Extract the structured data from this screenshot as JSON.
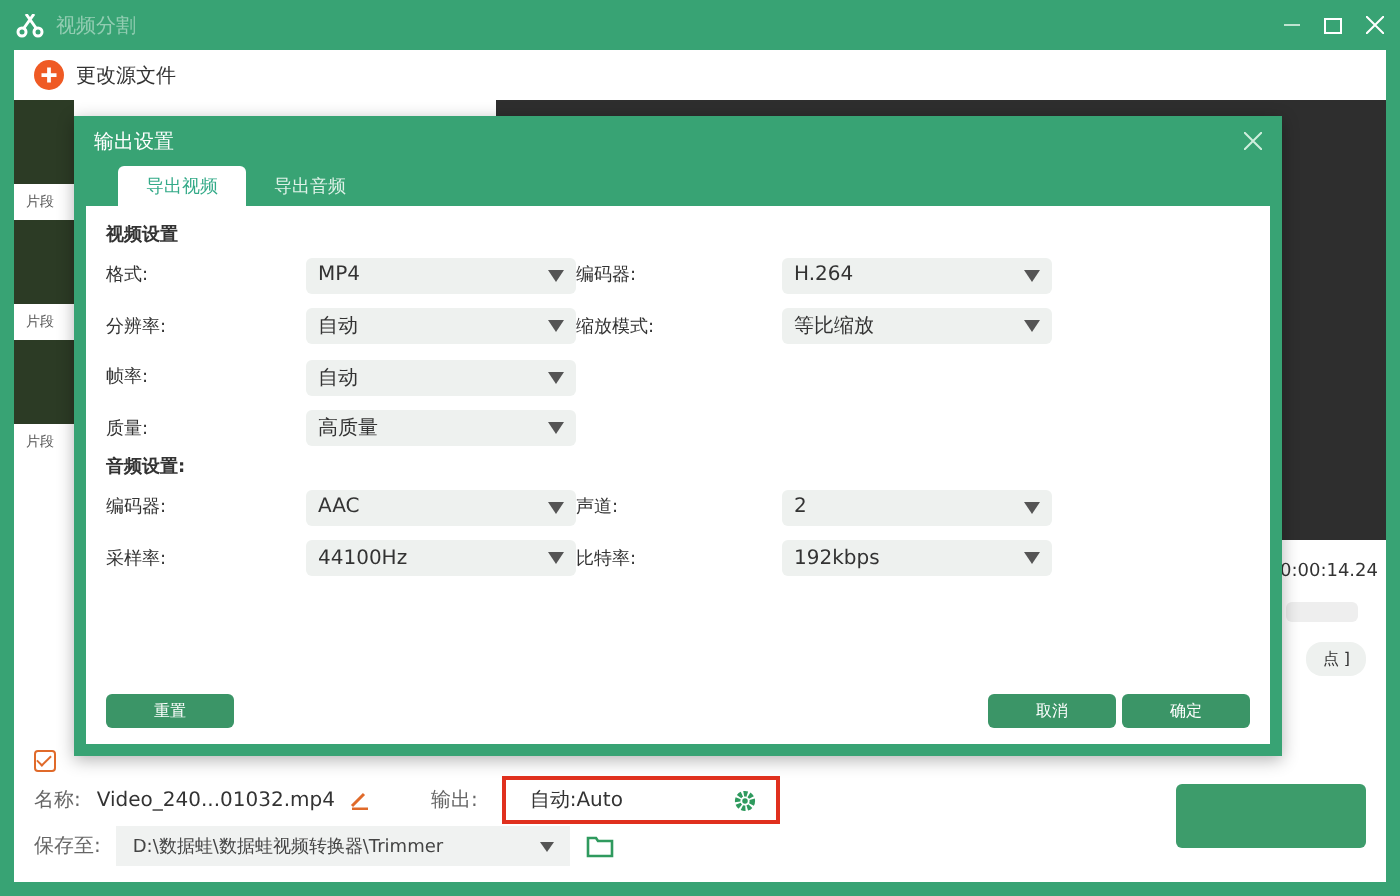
{
  "window": {
    "title": "视频分割"
  },
  "toolbar": {
    "change_source": "更改源文件"
  },
  "clips": [
    {
      "label": "片段"
    },
    {
      "label": "片段"
    },
    {
      "label": "片段"
    }
  ],
  "preview": {
    "time": "0:00:14.24",
    "mark_button": "点 ]"
  },
  "dialog": {
    "title": "输出设置",
    "tabs": [
      {
        "label": "导出视频",
        "selected": true
      },
      {
        "label": "导出音频",
        "selected": false
      }
    ],
    "video_section": "视频设置",
    "video_rows": [
      [
        {
          "label": "格式:",
          "value": "MP4"
        },
        {
          "label": "编码器:",
          "value": "H.264"
        }
      ],
      [
        {
          "label": "分辨率:",
          "value": "自动"
        },
        {
          "label": "缩放模式:",
          "value": "等比缩放"
        }
      ],
      [
        {
          "label": "帧率:",
          "value": "自动"
        }
      ],
      [
        {
          "label": "质量:",
          "value": "高质量"
        }
      ]
    ],
    "audio_section": "音频设置:",
    "audio_rows": [
      [
        {
          "label": "编码器:",
          "value": "AAC"
        },
        {
          "label": "声道:",
          "value": "2"
        }
      ],
      [
        {
          "label": "采样率:",
          "value": "44100Hz"
        },
        {
          "label": "比特率:",
          "value": "192kbps"
        }
      ]
    ],
    "reset": "重置",
    "cancel": "取消",
    "ok": "确定"
  },
  "bottom": {
    "checked": true,
    "name_label": "名称:",
    "name_value": "Video_240...01032.mp4",
    "output_label": "输出:",
    "output_value": "自动:Auto",
    "save_label": "保存至:",
    "save_path": "D:\\数据蛙\\数据蛙视频转换器\\Trimmer"
  }
}
